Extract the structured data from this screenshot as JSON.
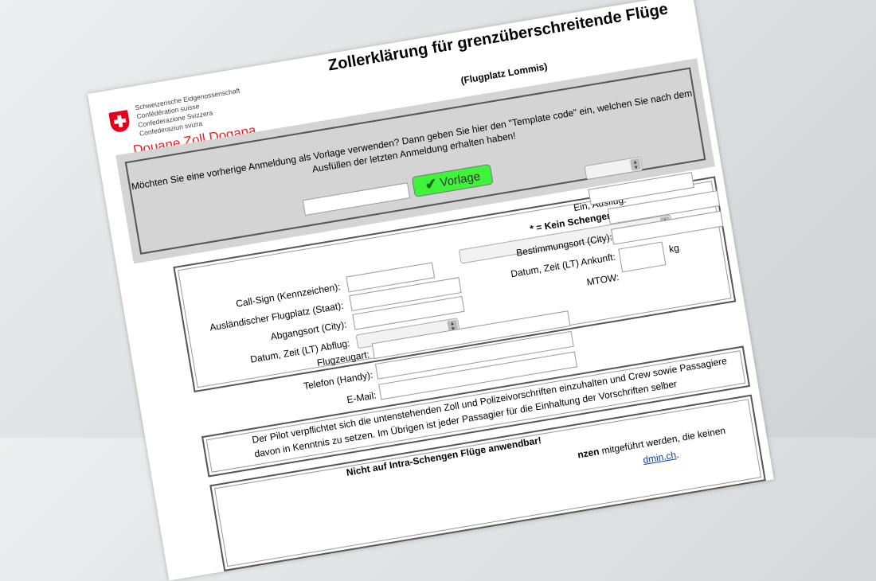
{
  "header": {
    "admin_lines": [
      "Schweizerische Eidgenossenschaft",
      "Confédération suisse",
      "Confederazione Svizzera",
      "Confederaziun svizra"
    ],
    "douane": "Douane  Zoll  Dogana",
    "title": "Zollerklärung für grenzüberschreitende Flüge",
    "subtitle": "(Flugplatz Lommis)"
  },
  "template": {
    "text": "Möchten Sie eine vorherige Anmeldung als Vorlage verwenden? Dann geben Sie hier den \"Template code\" ein, welchen Sie nach dem Ausfüllen der letzten Anmeldung erhalten haben!",
    "button_label": "Vorlage",
    "input_value": ""
  },
  "form": {
    "left": [
      {
        "label": "Call-Sign (Kennzeichen):",
        "value": ""
      },
      {
        "label": "Ausländischer Flugplatz (Staat):",
        "value": ""
      },
      {
        "label": "Abgangsort (City):",
        "value": ""
      },
      {
        "label": "Datum, Zeit (LT) Abflug:",
        "value": ""
      },
      {
        "label": "Flugzeugart:",
        "value": ""
      },
      {
        "label": "Telefon (Handy):",
        "value": ""
      },
      {
        "label": "E-Mail:",
        "value": ""
      }
    ],
    "right": [
      {
        "label": "Ein, Ausflug:",
        "value": ""
      },
      {
        "label": "Bestimmungsort (City):",
        "value": ""
      },
      {
        "label": "Datum, Zeit (LT) Ankunft:",
        "value": ""
      },
      {
        "label": "MTOW:",
        "value": ""
      }
    ],
    "schengen_note": "* = Kein Schengen Staat",
    "mtow_unit": "kg"
  },
  "notes": {
    "pilot_text_1": "Der Pilot verpflichtet sich die untenstehenden Zoll und Polizeivorschriften einzuhalten und Crew sowie Passagiere",
    "pilot_text_2": "davon in Kenntnis zu setzen. Im Übrigen ist jeder Passagier für die Einhaltung der Vorschriften selber",
    "rules_heading": "Nicht auf Intra-Schengen Flüge anwendbar!",
    "rules_fragment": "nzen",
    "rules_fragment2": "mitgeführt werden, die keinen",
    "link_fragment": "dmin.ch"
  }
}
